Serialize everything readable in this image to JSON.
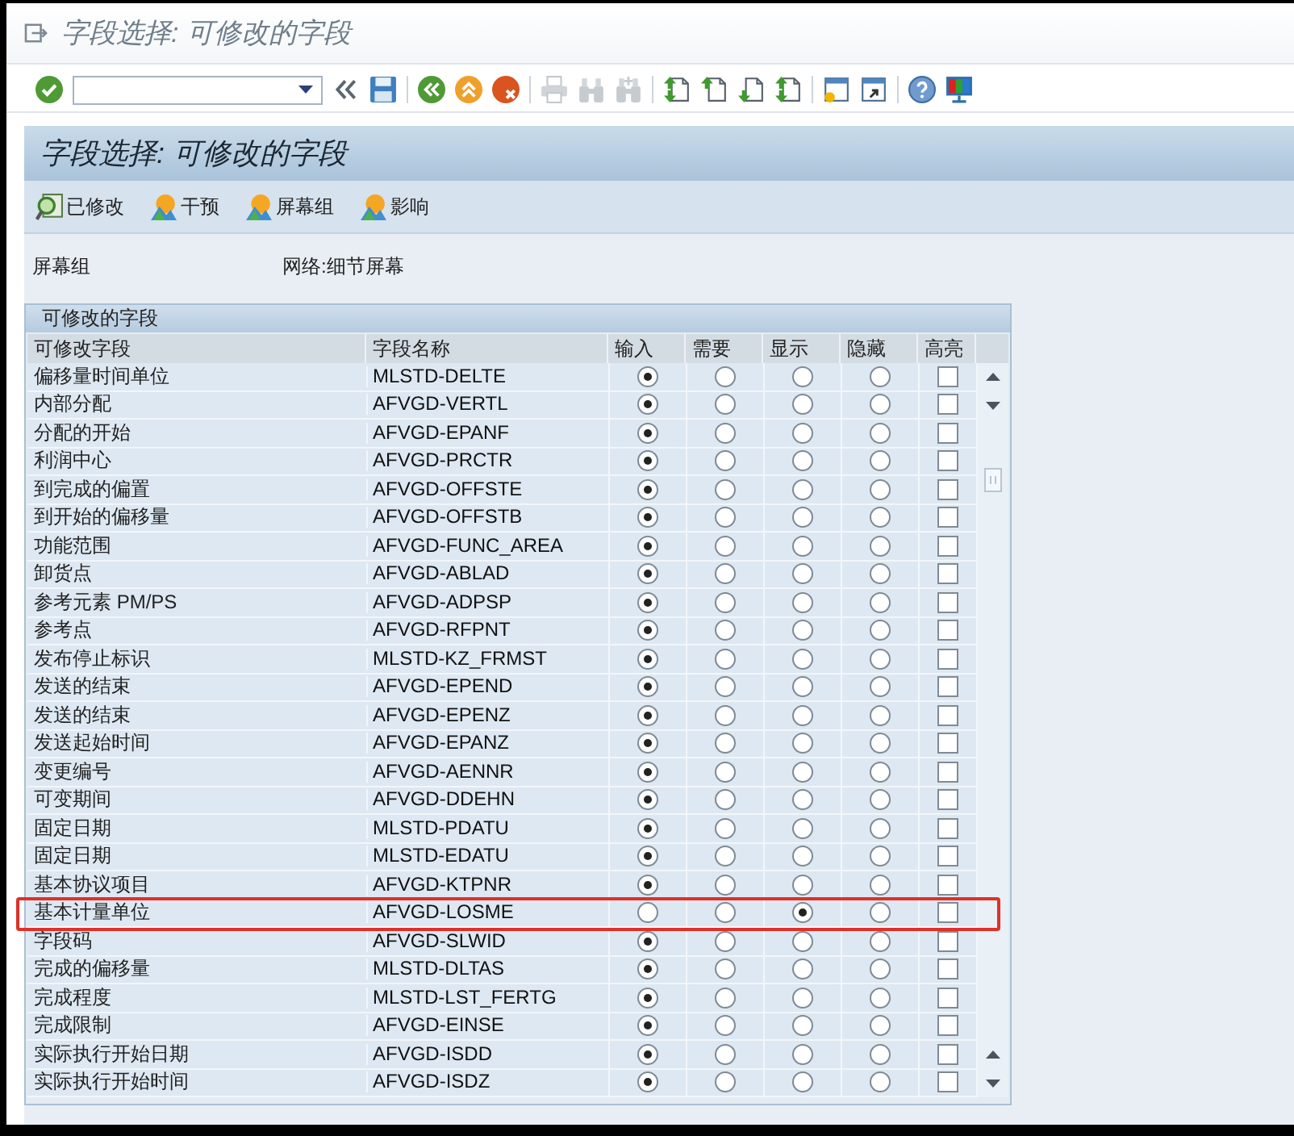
{
  "window": {
    "title": "字段选择: 可修改的字段"
  },
  "toolbar": [
    {
      "kind": "enter",
      "disabled": false
    },
    {
      "kind": "command"
    },
    {
      "kind": "collapse",
      "disabled": false
    },
    {
      "kind": "save",
      "disabled": false
    },
    {
      "kind": "separator"
    },
    {
      "kind": "back",
      "disabled": false
    },
    {
      "kind": "exit",
      "disabled": false
    },
    {
      "kind": "cancel",
      "disabled": false
    },
    {
      "kind": "separator"
    },
    {
      "kind": "print",
      "disabled": true
    },
    {
      "kind": "find",
      "disabled": true
    },
    {
      "kind": "find_next",
      "disabled": true
    },
    {
      "kind": "separator"
    },
    {
      "kind": "first_page",
      "disabled": false
    },
    {
      "kind": "previous_page",
      "disabled": false
    },
    {
      "kind": "next_page",
      "disabled": false
    },
    {
      "kind": "last_page",
      "disabled": false
    },
    {
      "kind": "separator"
    },
    {
      "kind": "new_session",
      "disabled": false
    },
    {
      "kind": "shortcut",
      "disabled": false
    },
    {
      "kind": "separator"
    },
    {
      "kind": "help",
      "disabled": false
    },
    {
      "kind": "layout",
      "disabled": false
    }
  ],
  "page_header": {
    "title": "字段选择: 可修改的字段"
  },
  "app_toolbar": [
    {
      "kind": "magnify",
      "label": "已修改"
    },
    {
      "kind": "landscape",
      "label": "干预"
    },
    {
      "kind": "landscape",
      "label": "屏幕组"
    },
    {
      "kind": "landscape",
      "label": "影响"
    }
  ],
  "screen_group": {
    "label": "屏幕组",
    "value": "网络:细节屏幕"
  },
  "group": {
    "title": "可修改的字段",
    "table": {
      "columns": [
        {
          "label": "可修改字段"
        },
        {
          "label": "字段名称"
        },
        {
          "label": "输入"
        },
        {
          "label": "需要"
        },
        {
          "label": "显示"
        },
        {
          "label": "隐藏"
        },
        {
          "label": "高亮"
        }
      ],
      "rows": [
        {
          "field": "偏移量时间单位",
          "name": "MLSTD-DELTE",
          "options": [
            {
              "selected": true
            },
            {
              "selected": false
            },
            {
              "selected": false
            },
            {
              "selected": false
            }
          ],
          "checked": false,
          "framed": false
        },
        {
          "field": "内部分配",
          "name": "AFVGD-VERTL",
          "options": [
            {
              "selected": true
            },
            {
              "selected": false
            },
            {
              "selected": false
            },
            {
              "selected": false
            }
          ],
          "checked": false,
          "framed": false
        },
        {
          "field": "分配的开始",
          "name": "AFVGD-EPANF",
          "options": [
            {
              "selected": true
            },
            {
              "selected": false
            },
            {
              "selected": false
            },
            {
              "selected": false
            }
          ],
          "checked": false,
          "framed": false
        },
        {
          "field": "利润中心",
          "name": "AFVGD-PRCTR",
          "options": [
            {
              "selected": true
            },
            {
              "selected": false
            },
            {
              "selected": false
            },
            {
              "selected": false
            }
          ],
          "checked": false,
          "framed": false
        },
        {
          "field": "到完成的偏置",
          "name": "AFVGD-OFFSTE",
          "options": [
            {
              "selected": true
            },
            {
              "selected": false
            },
            {
              "selected": false
            },
            {
              "selected": false
            }
          ],
          "checked": false,
          "framed": false
        },
        {
          "field": "到开始的偏移量",
          "name": "AFVGD-OFFSTB",
          "options": [
            {
              "selected": true
            },
            {
              "selected": false
            },
            {
              "selected": false
            },
            {
              "selected": false
            }
          ],
          "checked": false,
          "framed": false
        },
        {
          "field": "功能范围",
          "name": "AFVGD-FUNC_AREA",
          "options": [
            {
              "selected": true
            },
            {
              "selected": false
            },
            {
              "selected": false
            },
            {
              "selected": false
            }
          ],
          "checked": false,
          "framed": false
        },
        {
          "field": "卸货点",
          "name": "AFVGD-ABLAD",
          "options": [
            {
              "selected": true
            },
            {
              "selected": false
            },
            {
              "selected": false
            },
            {
              "selected": false
            }
          ],
          "checked": false,
          "framed": false
        },
        {
          "field": "参考元素 PM/PS",
          "name": "AFVGD-ADPSP",
          "options": [
            {
              "selected": true
            },
            {
              "selected": false
            },
            {
              "selected": false
            },
            {
              "selected": false
            }
          ],
          "checked": false,
          "framed": false
        },
        {
          "field": "参考点",
          "name": "AFVGD-RFPNT",
          "options": [
            {
              "selected": true
            },
            {
              "selected": false
            },
            {
              "selected": false
            },
            {
              "selected": false
            }
          ],
          "checked": false,
          "framed": false
        },
        {
          "field": "发布停止标识",
          "name": "MLSTD-KZ_FRMST",
          "options": [
            {
              "selected": true
            },
            {
              "selected": false
            },
            {
              "selected": false
            },
            {
              "selected": false
            }
          ],
          "checked": false,
          "framed": false
        },
        {
          "field": "发送的结束",
          "name": "AFVGD-EPEND",
          "options": [
            {
              "selected": true
            },
            {
              "selected": false
            },
            {
              "selected": false
            },
            {
              "selected": false
            }
          ],
          "checked": false,
          "framed": false
        },
        {
          "field": "发送的结束",
          "name": "AFVGD-EPENZ",
          "options": [
            {
              "selected": true
            },
            {
              "selected": false
            },
            {
              "selected": false
            },
            {
              "selected": false
            }
          ],
          "checked": false,
          "framed": false
        },
        {
          "field": "发送起始时间",
          "name": "AFVGD-EPANZ",
          "options": [
            {
              "selected": true
            },
            {
              "selected": false
            },
            {
              "selected": false
            },
            {
              "selected": false
            }
          ],
          "checked": false,
          "framed": false
        },
        {
          "field": "变更编号",
          "name": "AFVGD-AENNR",
          "options": [
            {
              "selected": true
            },
            {
              "selected": false
            },
            {
              "selected": false
            },
            {
              "selected": false
            }
          ],
          "checked": false,
          "framed": false
        },
        {
          "field": "可变期间",
          "name": "AFVGD-DDEHN",
          "options": [
            {
              "selected": true
            },
            {
              "selected": false
            },
            {
              "selected": false
            },
            {
              "selected": false
            }
          ],
          "checked": false,
          "framed": false
        },
        {
          "field": "固定日期",
          "name": "MLSTD-PDATU",
          "options": [
            {
              "selected": true
            },
            {
              "selected": false
            },
            {
              "selected": false
            },
            {
              "selected": false
            }
          ],
          "checked": false,
          "framed": false
        },
        {
          "field": "固定日期",
          "name": "MLSTD-EDATU",
          "options": [
            {
              "selected": true
            },
            {
              "selected": false
            },
            {
              "selected": false
            },
            {
              "selected": false
            }
          ],
          "checked": false,
          "framed": false
        },
        {
          "field": "基本协议项目",
          "name": "AFVGD-KTPNR",
          "options": [
            {
              "selected": true
            },
            {
              "selected": false
            },
            {
              "selected": false
            },
            {
              "selected": false
            }
          ],
          "checked": false,
          "framed": false
        },
        {
          "field": "基本计量单位",
          "name": "AFVGD-LOSME",
          "options": [
            {
              "selected": false
            },
            {
              "selected": false
            },
            {
              "selected": true
            },
            {
              "selected": false
            }
          ],
          "checked": false,
          "framed": true
        },
        {
          "field": "字段码",
          "name": "AFVGD-SLWID",
          "options": [
            {
              "selected": true
            },
            {
              "selected": false
            },
            {
              "selected": false
            },
            {
              "selected": false
            }
          ],
          "checked": false,
          "framed": false
        },
        {
          "field": "完成的偏移量",
          "name": "MLSTD-DLTAS",
          "options": [
            {
              "selected": true
            },
            {
              "selected": false
            },
            {
              "selected": false
            },
            {
              "selected": false
            }
          ],
          "checked": false,
          "framed": false
        },
        {
          "field": "完成程度",
          "name": "MLSTD-LST_FERTG",
          "options": [
            {
              "selected": true
            },
            {
              "selected": false
            },
            {
              "selected": false
            },
            {
              "selected": false
            }
          ],
          "checked": false,
          "framed": false
        },
        {
          "field": "完成限制",
          "name": "AFVGD-EINSE",
          "options": [
            {
              "selected": true
            },
            {
              "selected": false
            },
            {
              "selected": false
            },
            {
              "selected": false
            }
          ],
          "checked": false,
          "framed": false
        },
        {
          "field": "实际执行开始日期",
          "name": "AFVGD-ISDD",
          "options": [
            {
              "selected": true
            },
            {
              "selected": false
            },
            {
              "selected": false
            },
            {
              "selected": false
            }
          ],
          "checked": false,
          "framed": false
        },
        {
          "field": "实际执行开始时间",
          "name": "AFVGD-ISDZ",
          "options": [
            {
              "selected": true
            },
            {
              "selected": false
            },
            {
              "selected": false
            },
            {
              "selected": false
            }
          ],
          "checked": false,
          "framed": false
        }
      ]
    }
  }
}
